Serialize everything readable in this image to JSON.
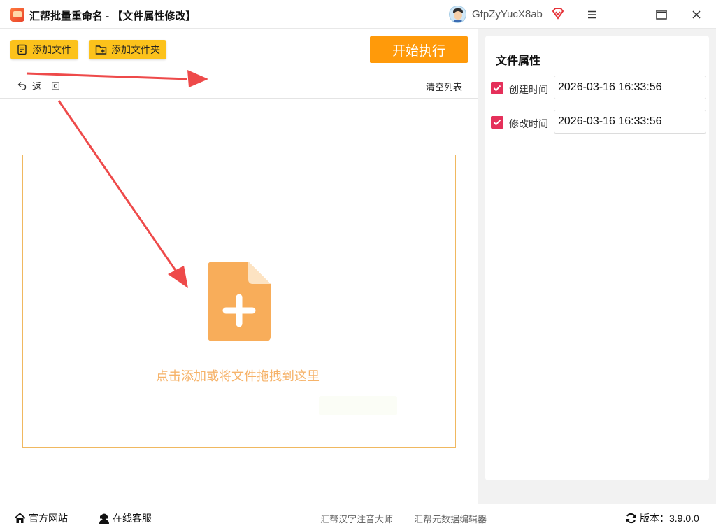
{
  "titlebar": {
    "title": "汇帮批量重命名 - 【文件属性修改】",
    "username": "GfpZyYucX8ab"
  },
  "toolbar": {
    "add_file": "添加文件",
    "add_folder": "添加文件夹",
    "start": "开始执行",
    "back": "返回",
    "clear_list": "清空列表"
  },
  "dropzone": {
    "hint": "点击添加或将文件拖拽到这里"
  },
  "right_panel": {
    "title": "文件属性",
    "rows": [
      {
        "label": "创建时间",
        "value": "2026-03-16 16:33:56",
        "checked": true
      },
      {
        "label": "修改时间",
        "value": "2026-03-16 16:33:56",
        "checked": true
      }
    ]
  },
  "statusbar": {
    "website": "官方网站",
    "support": "在线客服",
    "link1": "汇帮汉字注音大师",
    "link2": "汇帮元数据编辑器",
    "version": "版本：3.9.0.0"
  },
  "colors": {
    "accent_yellow": "#fcc21b",
    "accent_orange": "#ff9a0a",
    "checkbox": "#e5305a",
    "drop_icon": "#f8ad5a",
    "annotation_arrow": "#ee4a4a"
  },
  "icons": [
    "app-icon",
    "avatar",
    "vip-icon",
    "menu-icon",
    "maximize-icon",
    "close-icon",
    "add-file-icon",
    "add-folder-icon",
    "back-icon",
    "file-plus-icon",
    "home-icon",
    "support-icon",
    "refresh-icon"
  ]
}
